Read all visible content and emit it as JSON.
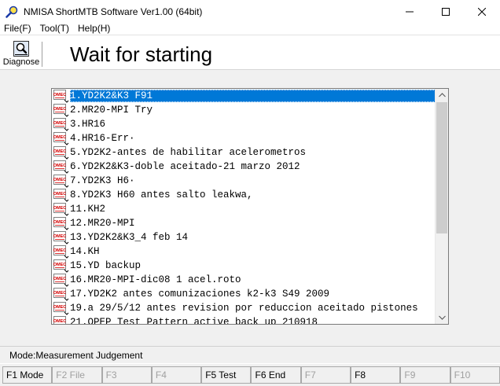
{
  "window": {
    "title": "NMISA ShortMTB Software Ver1.00 (64bit)",
    "minimize": "—",
    "maximize": "☐",
    "close": "✕"
  },
  "menu": [
    "File(F)",
    "Tool(T)",
    "Help(H)"
  ],
  "toolbar": {
    "diagnose_label": "Diagnose",
    "status_title": "Wait for starting"
  },
  "list": {
    "items": [
      "1.YD2K2&K3 F91",
      "2.MR20-MPI Try",
      "3.HR16",
      "4.HR16-Err·",
      "5.YD2K2-antes de habilitar acelerometros",
      "6.YD2K2&K3-doble aceitado-21 marzo 2012",
      "7.YD2K3 H6·",
      "8.YD2K3 H60 antes salto leakwa,",
      "11.KH2",
      "12.MR20-MPI",
      "13.YD2K2&K3_4 feb 14",
      "14.KH",
      "15.YD backup",
      "16.MR20-MPI-dic08 1 acel.roto",
      "17.YD2K2 antes comunizaciones k2-k3 S49 2009",
      "19.a 29/5/12 antes revision por reduccion aceitado pistones",
      "21.OPEP Test Pattern active back up 210918"
    ],
    "selected_index": 0,
    "icon_text": "OMEC"
  },
  "mode": {
    "text": "Mode:Measurement Judgement"
  },
  "fkeys": [
    {
      "label": "F1 Mode",
      "enabled": true
    },
    {
      "label": "F2 File",
      "enabled": false
    },
    {
      "label": "F3",
      "enabled": false
    },
    {
      "label": "F4",
      "enabled": false
    },
    {
      "label": "F5 Test",
      "enabled": true
    },
    {
      "label": "F6 End",
      "enabled": true
    },
    {
      "label": "F7",
      "enabled": false
    },
    {
      "label": "F8",
      "enabled": true
    },
    {
      "label": "F9",
      "enabled": false
    },
    {
      "label": "F10",
      "enabled": false
    }
  ],
  "colors": {
    "selection": "#0078d7",
    "icon_red": "#d40000"
  }
}
